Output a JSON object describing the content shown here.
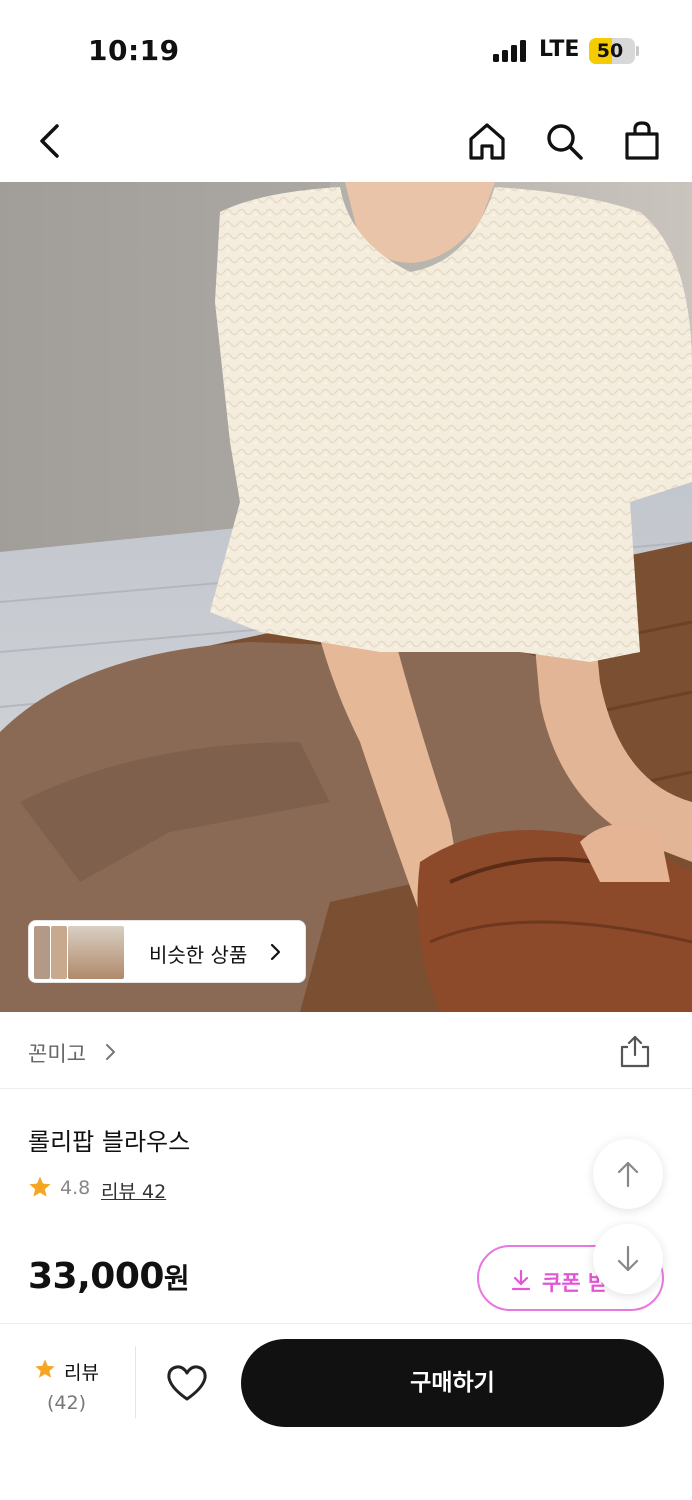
{
  "status_bar": {
    "time": "10:19",
    "network": "LTE",
    "battery": "50",
    "battery_level": 0.5
  },
  "nav": {
    "icons": [
      "back-icon",
      "home-icon",
      "search-icon",
      "cart-bag-icon"
    ]
  },
  "hero": {
    "similar_products_label": "비슷한 상품"
  },
  "brand": {
    "name": "꼰미고"
  },
  "product": {
    "name": "롤리팝 블라우스",
    "rating": "4.8",
    "review_link": "리뷰 42",
    "price": "33,000",
    "price_unit": "원",
    "coupon_label": "쿠폰 받기"
  },
  "bottom_bar": {
    "review_label": "리뷰",
    "review_count": "(42)",
    "buy_label": "구매하기"
  },
  "colors": {
    "accent": "#e356d6",
    "star": "#f5a623",
    "buy_button": "#111111",
    "battery": "#f5cc00"
  }
}
